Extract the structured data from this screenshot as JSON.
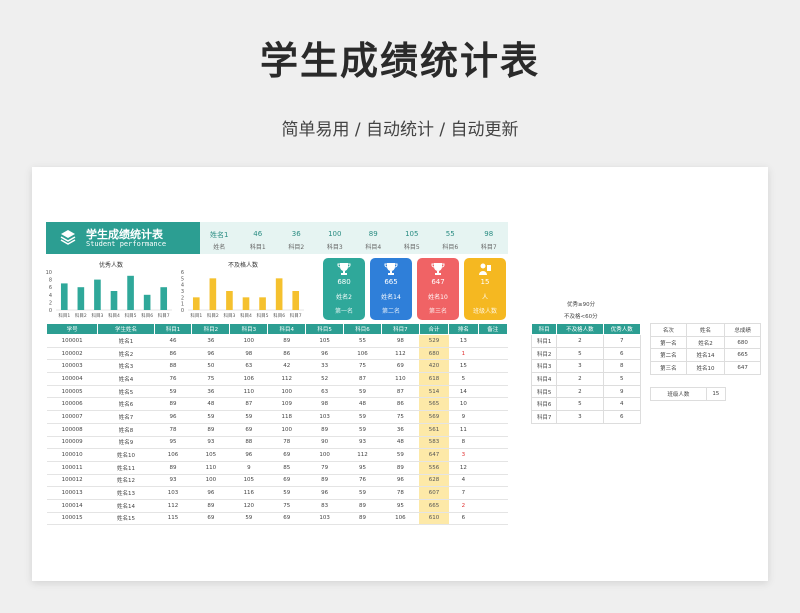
{
  "page": {
    "title": "学生成绩统计表",
    "subtitle": "简单易用 / 自动统计 / 自动更新"
  },
  "banner": {
    "title": "学生成绩统计表",
    "subtitle": "Student performance"
  },
  "top_row": [
    {
      "value": "姓名1",
      "label": "姓名"
    },
    {
      "value": "46",
      "label": "科目1"
    },
    {
      "value": "36",
      "label": "科目2"
    },
    {
      "value": "100",
      "label": "科目3"
    },
    {
      "value": "89",
      "label": "科目4"
    },
    {
      "value": "105",
      "label": "科目5"
    },
    {
      "value": "55",
      "label": "科目6"
    },
    {
      "value": "98",
      "label": "科目7"
    }
  ],
  "chart_data": [
    {
      "type": "bar",
      "title": "优秀人数",
      "categories": [
        "科目1",
        "科目2",
        "科目3",
        "科目4",
        "科目5",
        "科目6",
        "科目7"
      ],
      "values": [
        7,
        6,
        8,
        5,
        9,
        4,
        6
      ],
      "ylim": [
        0,
        10
      ],
      "yticks": [
        "0",
        "2",
        "4",
        "6",
        "8",
        "10"
      ],
      "color": "#2fa89a"
    },
    {
      "type": "bar",
      "title": "不及格人数",
      "categories": [
        "科目1",
        "科目2",
        "科目3",
        "科目4",
        "科目5",
        "科目6",
        "科目7"
      ],
      "values": [
        2,
        5,
        3,
        2,
        2,
        5,
        3
      ],
      "ylim": [
        0,
        6
      ],
      "yticks": [
        "0",
        "1",
        "2",
        "3",
        "4",
        "5",
        "6"
      ],
      "color": "#f5c12e"
    }
  ],
  "cards": [
    {
      "value": "680",
      "name": "姓名2",
      "rank": "第一名",
      "color": "#2fa89a",
      "icon": "trophy-icon"
    },
    {
      "value": "665",
      "name": "姓名14",
      "rank": "第二名",
      "color": "#2f7fd9",
      "icon": "trophy-icon"
    },
    {
      "value": "647",
      "name": "姓名10",
      "rank": "第三名",
      "color": "#f06365",
      "icon": "trophy-icon"
    },
    {
      "value": "15",
      "name": "人",
      "rank": "班级人数",
      "color": "#f5b821",
      "icon": "person-icon"
    }
  ],
  "main_table": {
    "headers": [
      "学号",
      "学生姓名",
      "科目1",
      "科目2",
      "科目3",
      "科目4",
      "科目5",
      "科目6",
      "科目7",
      "合计",
      "排名",
      "备注"
    ],
    "rows": [
      [
        "100001",
        "姓名1",
        "46",
        "36",
        "100",
        "89",
        "105",
        "55",
        "98",
        "529",
        "13",
        ""
      ],
      [
        "100002",
        "姓名2",
        "86",
        "96",
        "98",
        "86",
        "96",
        "106",
        "112",
        "680",
        "1",
        ""
      ],
      [
        "100003",
        "姓名3",
        "88",
        "50",
        "63",
        "42",
        "33",
        "75",
        "69",
        "420",
        "15",
        ""
      ],
      [
        "100004",
        "姓名4",
        "76",
        "75",
        "106",
        "112",
        "52",
        "87",
        "110",
        "618",
        "5",
        ""
      ],
      [
        "100005",
        "姓名5",
        "59",
        "36",
        "110",
        "100",
        "63",
        "59",
        "87",
        "514",
        "14",
        ""
      ],
      [
        "100006",
        "姓名6",
        "89",
        "48",
        "87",
        "109",
        "98",
        "48",
        "86",
        "565",
        "10",
        ""
      ],
      [
        "100007",
        "姓名7",
        "96",
        "59",
        "59",
        "118",
        "103",
        "59",
        "75",
        "569",
        "9",
        ""
      ],
      [
        "100008",
        "姓名8",
        "78",
        "89",
        "69",
        "100",
        "89",
        "59",
        "36",
        "561",
        "11",
        ""
      ],
      [
        "100009",
        "姓名9",
        "95",
        "93",
        "88",
        "78",
        "90",
        "93",
        "48",
        "583",
        "8",
        ""
      ],
      [
        "100010",
        "姓名10",
        "106",
        "105",
        "96",
        "69",
        "100",
        "112",
        "59",
        "647",
        "3",
        ""
      ],
      [
        "100011",
        "姓名11",
        "89",
        "110",
        "9",
        "85",
        "79",
        "95",
        "89",
        "556",
        "12",
        ""
      ],
      [
        "100012",
        "姓名12",
        "93",
        "100",
        "105",
        "69",
        "89",
        "76",
        "96",
        "628",
        "4",
        ""
      ],
      [
        "100013",
        "姓名13",
        "103",
        "96",
        "116",
        "59",
        "96",
        "59",
        "78",
        "607",
        "7",
        ""
      ],
      [
        "100014",
        "姓名14",
        "112",
        "89",
        "120",
        "75",
        "83",
        "89",
        "95",
        "665",
        "2",
        ""
      ],
      [
        "100015",
        "姓名15",
        "115",
        "69",
        "59",
        "69",
        "103",
        "89",
        "106",
        "610",
        "6",
        ""
      ]
    ]
  },
  "notes": {
    "excellent": "优秀≥90分",
    "fail": "不及格<60分"
  },
  "stat_table": {
    "headers": [
      "科目",
      "不及格人数",
      "优秀人数"
    ],
    "rows": [
      [
        "科目1",
        "2",
        "7"
      ],
      [
        "科目2",
        "5",
        "6"
      ],
      [
        "科目3",
        "3",
        "8"
      ],
      [
        "科目4",
        "2",
        "5"
      ],
      [
        "科目5",
        "2",
        "9"
      ],
      [
        "科目6",
        "5",
        "4"
      ],
      [
        "科目7",
        "3",
        "6"
      ]
    ]
  },
  "rank_table": {
    "headers": [
      "名次",
      "姓名",
      "总成绩"
    ],
    "rows": [
      [
        "第一名",
        "姓名2",
        "680"
      ],
      [
        "第二名",
        "姓名14",
        "665"
      ],
      [
        "第三名",
        "姓名10",
        "647"
      ]
    ]
  },
  "class_count": {
    "label": "班级人数",
    "value": "15"
  }
}
